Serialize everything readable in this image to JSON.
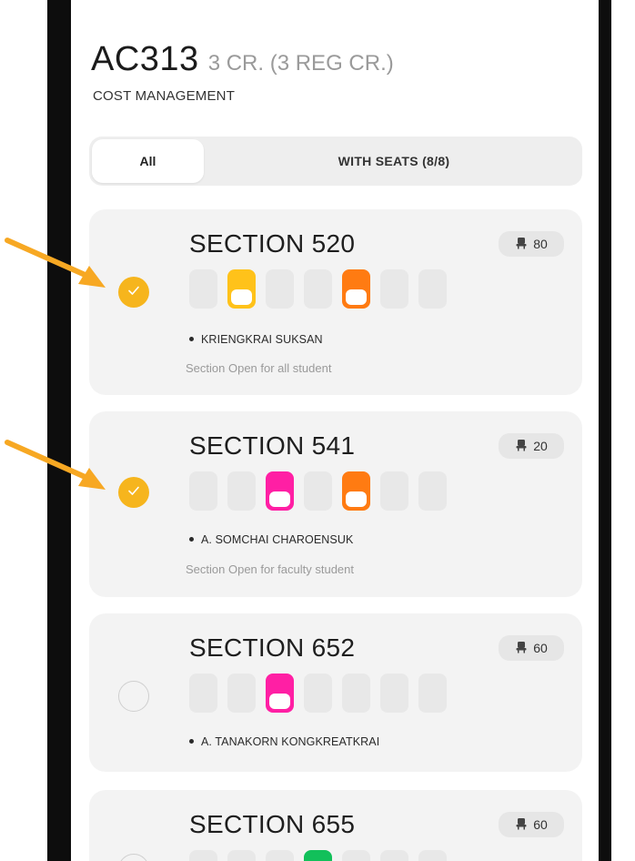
{
  "course": {
    "code": "AC313",
    "credits": "3 CR.  (3 REG CR.)",
    "name": "COST MANAGEMENT"
  },
  "filters": {
    "all": "All",
    "with_seats": "WITH SEATS (8/8)"
  },
  "colors": {
    "accent": "#f6b51d",
    "day_yellow": "#ffc21a",
    "day_orange": "#ff7b12",
    "day_pink": "#ff1fa4",
    "day_green": "#12c05a",
    "day_empty": "#e8e8e8"
  },
  "sections": [
    {
      "title": "SECTION 520",
      "seats": "80",
      "selected": true,
      "days": [
        "",
        "yellow",
        "",
        "",
        "orange",
        "",
        ""
      ],
      "instructor": "KRIENGKRAI SUKSAN",
      "note": "Section Open for all student"
    },
    {
      "title": "SECTION 541",
      "seats": "20",
      "selected": true,
      "days": [
        "",
        "",
        "pink",
        "",
        "orange",
        "",
        ""
      ],
      "instructor": "A. SOMCHAI CHAROENSUK",
      "note": "Section Open for faculty student"
    },
    {
      "title": "SECTION 652",
      "seats": "60",
      "selected": false,
      "days": [
        "",
        "",
        "pink",
        "",
        "",
        "",
        ""
      ],
      "instructor": "A. TANAKORN KONGKREATKRAI",
      "note": ""
    },
    {
      "title": "SECTION 655",
      "seats": "60",
      "selected": false,
      "days": [
        "",
        "",
        "",
        "green",
        "",
        "",
        ""
      ],
      "instructor": "",
      "note": ""
    }
  ]
}
